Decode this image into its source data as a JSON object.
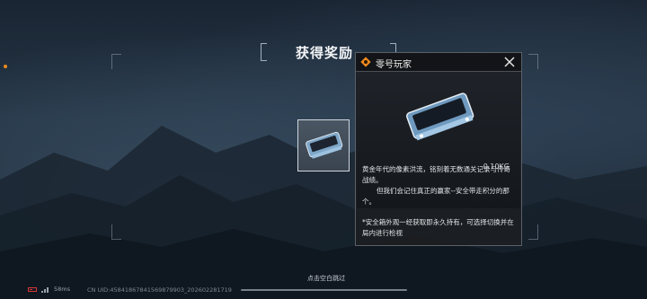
{
  "screen_title": "获得奖励",
  "item_panel": {
    "name": "零号玩家",
    "weight": "0.10KG",
    "description_line1": "黄金年代的像素洪流，铭刻着无数通关记录与传奇战绩。",
    "description_line2": "但我们会记住真正的赢家--安全带走积分的那个。",
    "note": "*安全箱外观一经获取即永久持有，可选择切换并在局内进行检视"
  },
  "skip_hint": "点击空白跳过",
  "status_bar": {
    "ping": "58ms",
    "uid": "CN UID:4584186784156987990​3_202602281719"
  },
  "colors": {
    "accent_orange": "#f08a1c",
    "battery_red": "#d63838",
    "panel_bg": "#1c1e22"
  },
  "icons": {
    "close": "close-icon",
    "item_badge": "diamond-badge-icon",
    "item": "secure-case-icon"
  }
}
